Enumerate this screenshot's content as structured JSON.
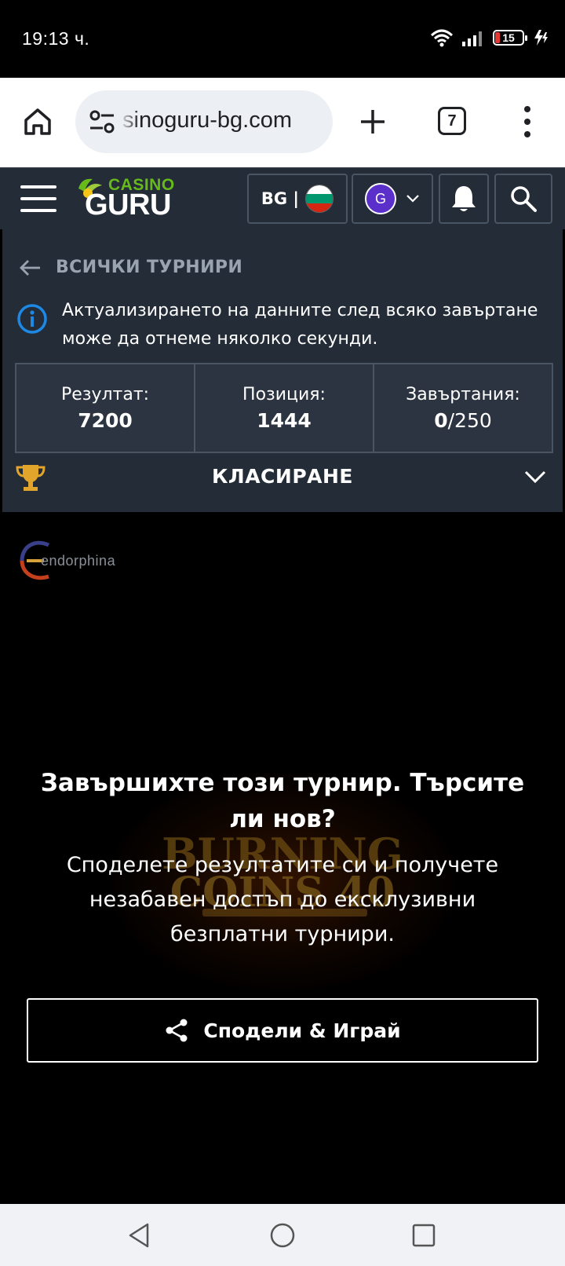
{
  "status_bar": {
    "time": "19:13 ч.",
    "battery": "15"
  },
  "browser": {
    "url": "sinoguru-bg.com",
    "tab_count": "7"
  },
  "site_header": {
    "logo_top": "CASINO",
    "logo_main": "GURU",
    "language": "BG |",
    "avatar_letter": "G"
  },
  "tournament": {
    "back_label": "ВСИЧКИ ТУРНИРИ",
    "info_text": "Актуализирането на данните след всяко завъртане може да отнеме няколко секунди.",
    "stats": {
      "result_label": "Резултат:",
      "result_value": "7200",
      "position_label": "Позиция:",
      "position_value": "1444",
      "spins_label": "Завъртания:",
      "spins_used": "0",
      "spins_total": "/250"
    },
    "ranking_label": "КЛАСИРАНЕ"
  },
  "game": {
    "provider": "endorphina",
    "logo_line1": "BURNING",
    "logo_line2": "COINS 40",
    "finish_title": "Завършихте този турнир. Търсите ли нов?",
    "finish_subtitle": "Споделете резултатите си и получете незабавен достъп до ексклузивни безплатни турнири.",
    "share_button": "Сподели & Играй"
  },
  "colors": {
    "header_bg": "#232c37",
    "accent_green": "#66bb1a",
    "info_blue": "#1e88e5",
    "trophy_gold": "#e0a52a"
  }
}
